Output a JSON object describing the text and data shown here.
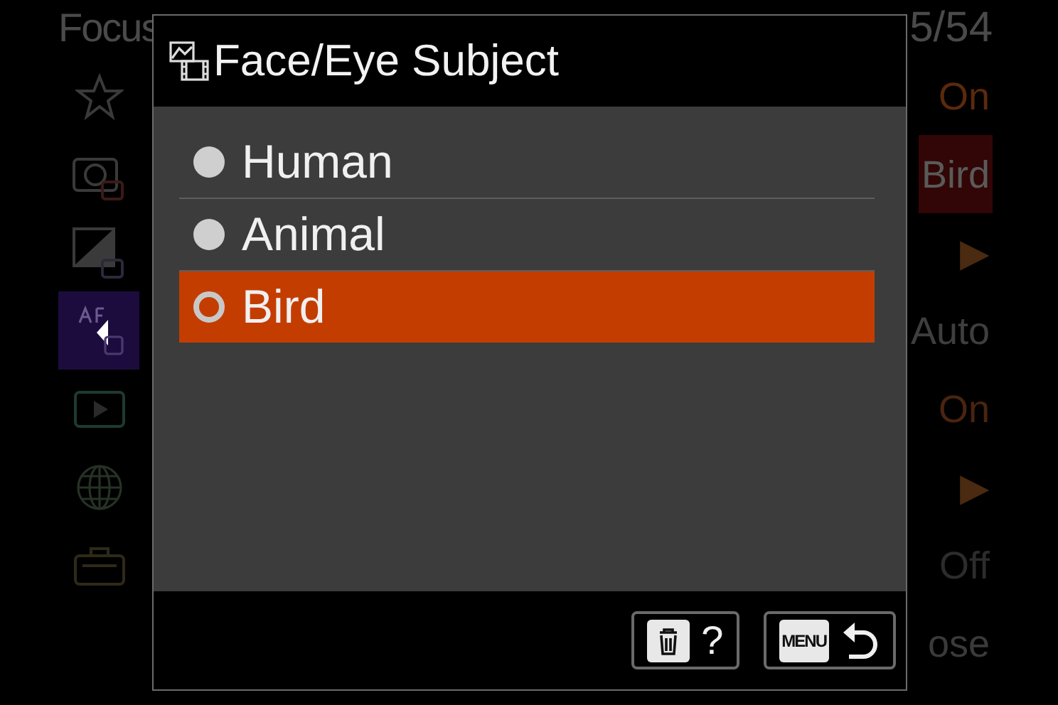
{
  "background_menu": {
    "title": "Focus",
    "page_counter": "5/54",
    "sidebar": [
      {
        "kind": "star",
        "selected": false
      },
      {
        "kind": "camera",
        "selected": false
      },
      {
        "kind": "exposure",
        "selected": false
      },
      {
        "kind": "af",
        "selected": true
      },
      {
        "kind": "play",
        "selected": false
      },
      {
        "kind": "globe",
        "selected": false
      },
      {
        "kind": "toolbox",
        "selected": false
      }
    ],
    "values": [
      {
        "text": "On",
        "color": "#5a2a0c",
        "selected": false
      },
      {
        "text": "Bird",
        "color": "#5a5a5a",
        "selected": true
      },
      {
        "text": "▶",
        "color": "#4a2a10",
        "selected": false
      },
      {
        "text": "Auto",
        "color": "#3e3e3e",
        "selected": false
      },
      {
        "text": "On",
        "color": "#4a2410",
        "selected": false
      },
      {
        "text": "▶",
        "color": "#4a2a10",
        "selected": false
      },
      {
        "text": "Off",
        "color": "#2c2c2c",
        "selected": false
      },
      {
        "text": "ose",
        "color": "#3a3a3a",
        "selected": false
      }
    ]
  },
  "dialog": {
    "title": "Face/Eye Subject",
    "options": [
      {
        "label": "Human",
        "selected": false
      },
      {
        "label": "Animal",
        "selected": false
      },
      {
        "label": "Bird",
        "selected": true
      }
    ],
    "buttons": [
      {
        "kind": "help",
        "label": "?"
      },
      {
        "kind": "back",
        "label": "MENU"
      }
    ]
  }
}
